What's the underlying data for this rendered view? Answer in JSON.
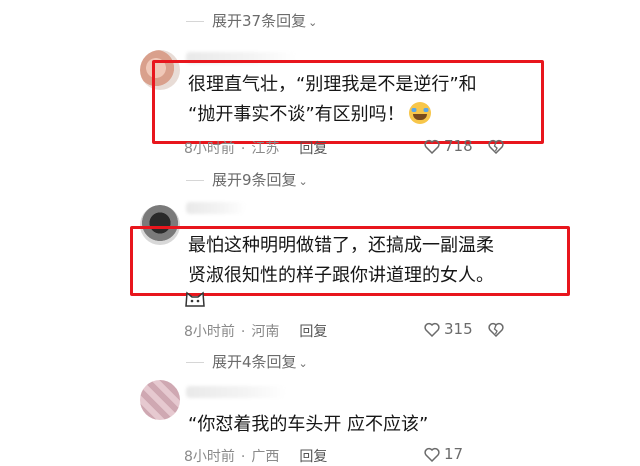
{
  "threads": [
    {
      "expand_label": "展开37条回复"
    },
    {
      "comment_line1": "很理直气壮，“别理我是不是逆行”和",
      "comment_line2": "“抛开事实不谈”有区别吗！",
      "time": "8小时前",
      "location": "江苏",
      "reply_label": "回复",
      "likes": "718",
      "expand_label": "展开9条回复"
    },
    {
      "comment_line1": "最怕这种明明做错了，还搞成一副温柔",
      "comment_line2": "贤淑很知性的样子跟你讲道理的女人。",
      "time": "8小时前",
      "location": "河南",
      "reply_label": "回复",
      "likes": "315",
      "expand_label": "展开4条回复"
    },
    {
      "comment_line1": "“你怼着我的车头开 应不应该”",
      "time": "8小时前",
      "location": "广西",
      "reply_label": "回复",
      "likes": "17"
    }
  ],
  "icons": {
    "like": "heart-outline-icon",
    "dislike": "broken-heart-icon",
    "chevron": "chevron-down-icon",
    "emoji": "crying-laughing-emoji"
  },
  "colors": {
    "highlight_box": "#e8161d",
    "meta_text": "#8a8a8a"
  }
}
